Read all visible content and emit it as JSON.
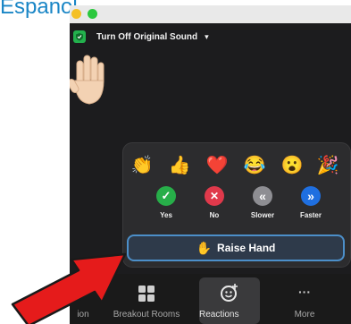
{
  "caption": {
    "text": "Espanol"
  },
  "window": {
    "original_sound": {
      "label": "Turn Off Original Sound",
      "caret": "▾",
      "shield_icon": "shield-check-icon"
    }
  },
  "reactions_panel": {
    "emojis": [
      {
        "icon": "clap-icon",
        "glyph": "👏"
      },
      {
        "icon": "thumbs-up-icon",
        "glyph": "👍"
      },
      {
        "icon": "heart-icon",
        "glyph": "❤️"
      },
      {
        "icon": "tears-of-joy-icon",
        "glyph": "😂"
      },
      {
        "icon": "open-mouth-icon",
        "glyph": "😮"
      },
      {
        "icon": "party-popper-icon",
        "glyph": "🎉"
      }
    ],
    "feedback": [
      {
        "label": "Yes",
        "icon": "check-icon",
        "color": "#27ae49",
        "glyph": "✓"
      },
      {
        "label": "No",
        "icon": "x-icon",
        "color": "#e0394b",
        "glyph": "✕"
      },
      {
        "label": "Slower",
        "icon": "double-chevron-left-icon",
        "color": "#8e8e93",
        "glyph": "«"
      },
      {
        "label": "Faster",
        "icon": "double-chevron-right-icon",
        "color": "#1f6fe0",
        "glyph": "»"
      }
    ],
    "raise_hand": {
      "label": "Raise Hand",
      "icon": "raised-hand-icon",
      "glyph": "✋"
    }
  },
  "toolbar": {
    "items": [
      {
        "label": "ion"
      },
      {
        "label": "Breakout Rooms",
        "icon": "grid-icon"
      },
      {
        "label": "Reactions",
        "icon": "emoji-add-icon"
      },
      {
        "label": "More",
        "icon": "ellipsis-icon",
        "glyph": "···"
      }
    ]
  },
  "colors": {
    "accent": "#4c8fc9",
    "arrow": "#e51b1b",
    "caption": "#1a86c6"
  }
}
